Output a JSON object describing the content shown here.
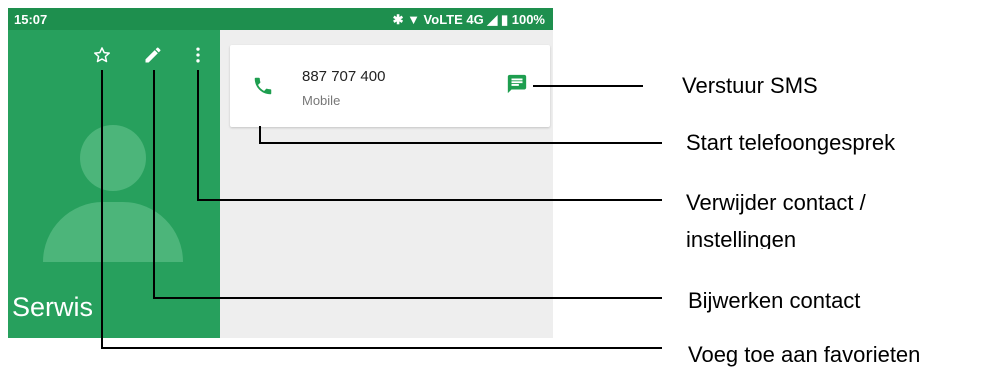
{
  "status_bar": {
    "time": "15:07",
    "indicators": "✱ ▼ VoLTE 4G ◢ ▮ 100%",
    "color": "#1e8f4e"
  },
  "contact": {
    "name": "Serwis",
    "header_color": "#27a05d",
    "actions": {
      "favorite_icon": "star-outline-icon",
      "edit_icon": "pencil-icon",
      "more_icon": "more-vert-icon"
    }
  },
  "phone_entry": {
    "number": "887 707 400",
    "type": "Mobile",
    "call_icon": "phone-icon",
    "sms_icon": "message-icon",
    "accent": "#1e9e4f"
  },
  "callouts": {
    "sms": "Verstuur SMS",
    "call": "Start telefoongesprek",
    "delete_line1": "Verwijder contact /",
    "delete_line2": "instellingen",
    "edit": "Bijwerken contact",
    "favorite": "Voeg toe aan favorieten"
  }
}
